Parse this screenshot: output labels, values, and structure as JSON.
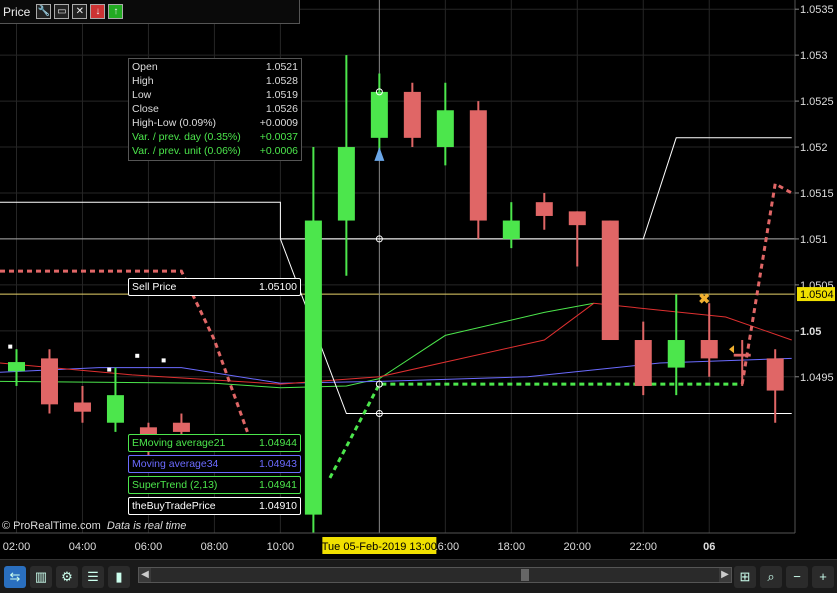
{
  "toolbar": {
    "title": "Price"
  },
  "credit": {
    "site": "© ProRealTime.com",
    "note": "Data is real time"
  },
  "info_panel": {
    "rows": [
      {
        "label": "Open",
        "value": "1.0521"
      },
      {
        "label": "High",
        "value": "1.0528"
      },
      {
        "label": "Low",
        "value": "1.0519"
      },
      {
        "label": "Close",
        "value": "1.0526"
      },
      {
        "label": "High-Low (0.09%)",
        "value": "+0.0009"
      },
      {
        "label": "Var. / prev. day (0.35%)",
        "value": "+0.0037"
      },
      {
        "label": "Var. / prev. unit (0.06%)",
        "value": "+0.0006"
      }
    ]
  },
  "indicator_labels": [
    {
      "label": "Sell Price",
      "value": "1.05100",
      "color": "#ffffff"
    },
    {
      "label": "EMoving average21",
      "value": "1.04944",
      "color": "#4ce64c"
    },
    {
      "label": "Moving average34",
      "value": "1.04943",
      "color": "#6b6bff"
    },
    {
      "label": "SuperTrend (2,13)",
      "value": "1.04941",
      "color": "#4ce64c"
    },
    {
      "label": "theBuyTradePrice",
      "value": "1.04910",
      "color": "#ffffff"
    }
  ],
  "chart_data": {
    "type": "candlestick",
    "title": "",
    "ylim": [
      1.0478,
      1.0536
    ],
    "y_ticks": [
      "1.0535",
      "1.053",
      "1.0525",
      "1.052",
      "1.0515",
      "1.051",
      "1.0505",
      "1.05",
      "1.0495"
    ],
    "y_tick_values": [
      1.0535,
      1.053,
      1.0525,
      1.052,
      1.0515,
      1.051,
      1.0505,
      1.05,
      1.0495
    ],
    "x_ticks": [
      "02:00",
      "04:00",
      "06:00",
      "08:00",
      "10:00",
      "16:00",
      "18:00",
      "20:00",
      "22:00",
      "06"
    ],
    "crosshair_label": "Tue 05-Feb-2019 13:00",
    "current_price": "1.0504",
    "up_color": "#4ce64c",
    "down_color": "#e06666",
    "candles": [
      {
        "t": 1,
        "o": 1.04956,
        "h": 1.0498,
        "l": 1.0494,
        "c": 1.04966
      },
      {
        "t": 3,
        "o": 1.0497,
        "h": 1.0498,
        "l": 1.0491,
        "c": 1.0492
      },
      {
        "t": 5,
        "o": 1.04922,
        "h": 1.0494,
        "l": 1.049,
        "c": 1.04912
      },
      {
        "t": 7,
        "o": 1.049,
        "h": 1.0496,
        "l": 1.0489,
        "c": 1.0493
      },
      {
        "t": 9,
        "o": 1.04895,
        "h": 1.049,
        "l": 1.0486,
        "c": 1.0488
      },
      {
        "t": 11,
        "o": 1.049,
        "h": 1.0491,
        "l": 1.0487,
        "c": 1.0489
      },
      {
        "t": 19,
        "o": 1.048,
        "h": 1.052,
        "l": 1.0478,
        "c": 1.0512
      },
      {
        "t": 21,
        "o": 1.0512,
        "h": 1.053,
        "l": 1.0506,
        "c": 1.052
      },
      {
        "t": 23,
        "o": 1.0521,
        "h": 1.0528,
        "l": 1.0519,
        "c": 1.0526
      },
      {
        "t": 25,
        "o": 1.0526,
        "h": 1.0527,
        "l": 1.052,
        "c": 1.0521
      },
      {
        "t": 27,
        "o": 1.052,
        "h": 1.0527,
        "l": 1.0518,
        "c": 1.0524
      },
      {
        "t": 29,
        "o": 1.0524,
        "h": 1.0525,
        "l": 1.051,
        "c": 1.0512
      },
      {
        "t": 31,
        "o": 1.051,
        "h": 1.0514,
        "l": 1.0509,
        "c": 1.0512
      },
      {
        "t": 33,
        "o": 1.0514,
        "h": 1.0515,
        "l": 1.0511,
        "c": 1.05125
      },
      {
        "t": 35,
        "o": 1.0513,
        "h": 1.0513,
        "l": 1.0507,
        "c": 1.05115
      },
      {
        "t": 37,
        "o": 1.0512,
        "h": 1.0512,
        "l": 1.0499,
        "c": 1.0499
      },
      {
        "t": 39,
        "o": 1.0499,
        "h": 1.0501,
        "l": 1.0493,
        "c": 1.0494
      },
      {
        "t": 41,
        "o": 1.0496,
        "h": 1.0504,
        "l": 1.0493,
        "c": 1.0499
      },
      {
        "t": 43,
        "o": 1.0499,
        "h": 1.0503,
        "l": 1.0495,
        "c": 1.0497
      },
      {
        "t": 45,
        "o": 1.04975,
        "h": 1.0499,
        "l": 1.0494,
        "c": 1.04972
      },
      {
        "t": 47,
        "o": 1.0497,
        "h": 1.0498,
        "l": 1.049,
        "c": 1.04935
      }
    ],
    "series": [
      {
        "name": "EMoving average21",
        "color": "#4ce64c",
        "points": [
          [
            0,
            1.04945
          ],
          [
            13,
            1.04943
          ],
          [
            17,
            1.04938
          ],
          [
            21,
            1.0494
          ],
          [
            23,
            1.04948
          ],
          [
            27,
            1.04995
          ],
          [
            33,
            1.0502
          ],
          [
            36,
            1.0503
          ]
        ]
      },
      {
        "name": "Moving average34",
        "color": "#6b6bff",
        "points": [
          [
            0,
            1.04955
          ],
          [
            6,
            1.0496
          ],
          [
            11,
            1.0496
          ],
          [
            17,
            1.04943
          ],
          [
            23,
            1.04945
          ],
          [
            32,
            1.0495
          ],
          [
            40,
            1.04965
          ],
          [
            48,
            1.0497
          ]
        ]
      },
      {
        "name": "EMA red",
        "color": "#e03030",
        "points": [
          [
            0,
            1.04965
          ],
          [
            8,
            1.04952
          ],
          [
            17,
            1.04942
          ],
          [
            23,
            1.0495
          ],
          [
            33,
            1.0499
          ],
          [
            36,
            1.0503
          ],
          [
            44,
            1.05015
          ],
          [
            48,
            1.0499
          ]
        ]
      },
      {
        "name": "Sell Price",
        "color": "#ffffff",
        "points": [
          [
            0,
            1.0514
          ],
          [
            17,
            1.0514
          ],
          [
            17,
            1.051
          ],
          [
            39,
            1.051
          ],
          [
            41,
            1.0521
          ],
          [
            48,
            1.0521
          ]
        ]
      },
      {
        "name": "theBuyTradePrice",
        "color": "#ffffff",
        "points": [
          [
            17,
            1.051
          ],
          [
            21,
            1.0491
          ],
          [
            48,
            1.0491
          ]
        ]
      }
    ],
    "supertrend_red": [
      [
        0,
        1.05065
      ],
      [
        11,
        1.05065
      ],
      [
        13,
        1.0499
      ],
      [
        15,
        1.0489
      ]
    ],
    "supertrend_green": [
      [
        20,
        1.0484
      ],
      [
        23,
        1.04942
      ],
      [
        45,
        1.04942
      ]
    ],
    "supertrend_red2": [
      [
        45,
        1.04942
      ],
      [
        47,
        1.0516
      ],
      [
        48,
        1.0515
      ]
    ]
  }
}
